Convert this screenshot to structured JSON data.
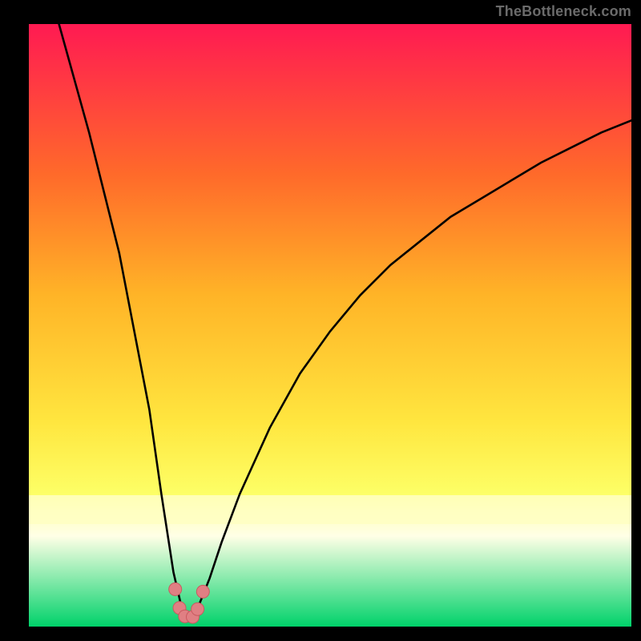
{
  "watermark": "TheBottleneck.com",
  "colors": {
    "frame": "#000000",
    "gradient_top": "#ff1a52",
    "gradient_mid1": "#ff6a2a",
    "gradient_mid2": "#ffb427",
    "gradient_mid3": "#ffe63f",
    "gradient_pale": "#ffffc0",
    "gradient_base_green": "#00d26a",
    "curve_stroke": "#000000",
    "marker_fill": "#e07f83",
    "marker_stroke": "#c85a5f"
  },
  "chart_data": {
    "type": "line",
    "title": "",
    "xlabel": "",
    "ylabel": "",
    "xlim": [
      0,
      100
    ],
    "ylim": [
      0,
      100
    ],
    "series": [
      {
        "name": "bottleneck-curve",
        "x": [
          5,
          10,
          15,
          20,
          22,
          24,
          25.5,
          27,
          28,
          30,
          32,
          35,
          40,
          45,
          50,
          55,
          60,
          65,
          70,
          75,
          80,
          85,
          90,
          95,
          100
        ],
        "values": [
          100,
          82,
          62,
          36,
          22,
          9,
          2.5,
          1.5,
          3,
          8,
          14,
          22,
          33,
          42,
          49,
          55,
          60,
          64,
          68,
          71,
          74,
          77,
          79.5,
          82,
          84
        ]
      }
    ],
    "markers": [
      {
        "x": 24.3,
        "y": 6.2
      },
      {
        "x": 25.0,
        "y": 3.1
      },
      {
        "x": 25.9,
        "y": 1.7
      },
      {
        "x": 27.2,
        "y": 1.6
      },
      {
        "x": 28.0,
        "y": 2.9
      },
      {
        "x": 28.9,
        "y": 5.8
      }
    ],
    "gradient_stops_pct": [
      0,
      25,
      45,
      66,
      78,
      81,
      85,
      100
    ],
    "annotations": []
  }
}
